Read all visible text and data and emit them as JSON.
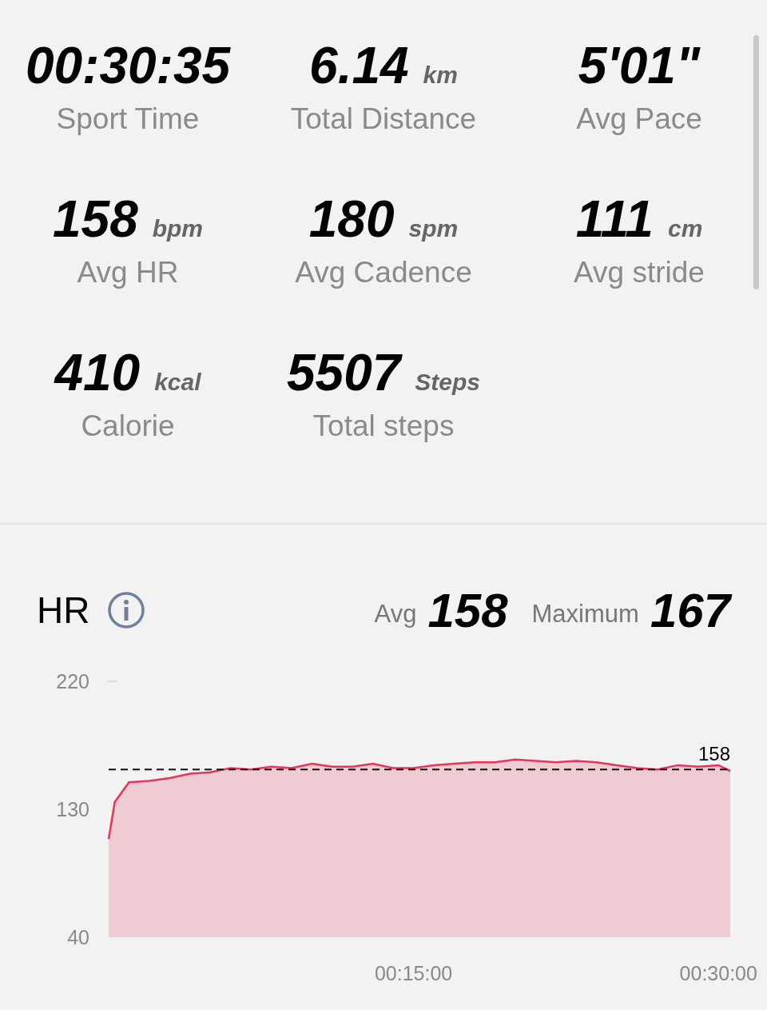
{
  "stats": [
    {
      "value": "00:30:35",
      "label": "Sport Time"
    },
    {
      "value": "6.14",
      "unit": "km",
      "label": "Total Distance"
    },
    {
      "value": "5'01\"",
      "label": "Avg Pace"
    },
    {
      "value": "158",
      "unit": "bpm",
      "label": "Avg HR"
    },
    {
      "value": "180",
      "unit": "spm",
      "label": "Avg Cadence"
    },
    {
      "value": "111",
      "unit": "cm",
      "label": "Avg stride"
    },
    {
      "value": "410",
      "unit": "kcal",
      "label": "Calorie"
    },
    {
      "value": "5507",
      "unit": "Steps",
      "label": "Total steps"
    }
  ],
  "hr": {
    "title": "HR",
    "avg_label": "Avg",
    "avg": "158",
    "max_label": "Maximum",
    "max": "167",
    "chart_data": {
      "type": "area",
      "xlim": [
        0,
        30.58
      ],
      "ylim": [
        40,
        220
      ],
      "yticks": [
        40,
        130,
        220
      ],
      "xticks": [
        {
          "value": 15,
          "label": "00:15:00"
        },
        {
          "value": 30,
          "label": "00:30:00"
        }
      ],
      "x": [
        0,
        0.3,
        1,
        2,
        3,
        4,
        5,
        6,
        7,
        8,
        9,
        10,
        11,
        12,
        13,
        14,
        15,
        16,
        17,
        18,
        19,
        20,
        21,
        22,
        23,
        24,
        25,
        26,
        27,
        28,
        29,
        30,
        30.58
      ],
      "series": [
        {
          "color": "#e8335a",
          "values": [
            109,
            135,
            149,
            150,
            152,
            155,
            156,
            159,
            158,
            160,
            159,
            162,
            160,
            160,
            162,
            159,
            159,
            161,
            162,
            163,
            163,
            165,
            164,
            163,
            164,
            163,
            161,
            159,
            158,
            161,
            160,
            161,
            157
          ]
        },
        {
          "type": "line",
          "line_style": "dashed",
          "color": "#111111",
          "values": [
            158,
            158,
            158,
            158,
            158,
            158,
            158,
            158,
            158,
            158,
            158,
            158,
            158,
            158,
            158,
            158,
            158,
            158,
            158,
            158,
            158,
            158,
            158,
            158,
            158,
            158,
            158,
            158,
            158,
            158,
            158,
            158,
            158
          ]
        }
      ],
      "annotations": [
        {
          "text": "158",
          "x": 30.58,
          "y": 158
        }
      ]
    }
  }
}
